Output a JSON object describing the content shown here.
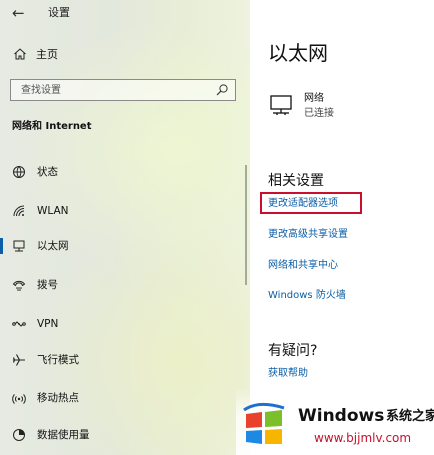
{
  "titlebar": {
    "title": "设置"
  },
  "sidebar": {
    "home_label": "主页",
    "search_placeholder": "查找设置",
    "section_heading": "网络和 Internet",
    "items": [
      {
        "label": "状态",
        "icon": "globe-icon",
        "active": false
      },
      {
        "label": "WLAN",
        "icon": "wifi-icon",
        "active": false
      },
      {
        "label": "以太网",
        "icon": "ethernet-icon",
        "active": true
      },
      {
        "label": "拨号",
        "icon": "dialup-icon",
        "active": false
      },
      {
        "label": "VPN",
        "icon": "vpn-icon",
        "active": false
      },
      {
        "label": "飞行模式",
        "icon": "airplane-icon",
        "active": false
      },
      {
        "label": "移动热点",
        "icon": "hotspot-icon",
        "active": false
      },
      {
        "label": "数据使用量",
        "icon": "data-usage-icon",
        "active": false
      }
    ]
  },
  "main": {
    "title": "以太网",
    "network": {
      "name": "网络",
      "status": "已连接"
    },
    "related_heading": "相关设置",
    "related_links": [
      "更改适配器选项",
      "更改高级共享设置",
      "网络和共享中心",
      "Windows 防火墙"
    ],
    "help_heading": "有疑问?",
    "help_link": "获取帮助"
  },
  "watermark": {
    "brand": "Windows",
    "brand_cn": "系统之家",
    "url": "www.bjjmlv.com"
  },
  "colors": {
    "link": "#0a5ea6",
    "accent": "#0b5ea8",
    "highlight": "#c8102e"
  }
}
